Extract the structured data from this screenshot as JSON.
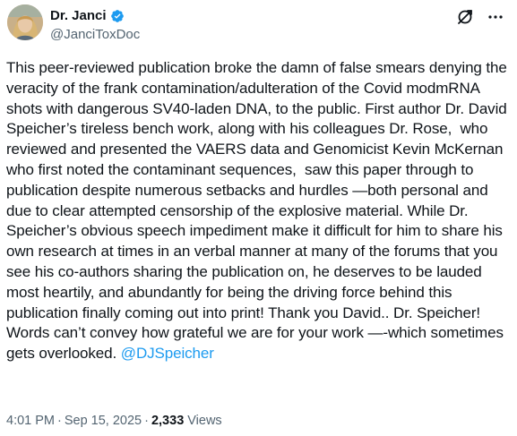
{
  "author": {
    "display_name": "Dr. Janci",
    "handle": "@JanciToxDoc",
    "verified_color": "#1d9bf0"
  },
  "icons": {
    "grok": "grok-icon",
    "more": "more-icon",
    "verified": "verified-badge-icon"
  },
  "post": {
    "text": "This peer-reviewed publication broke the damn of false smears denying the veracity of the frank contamination/adulteration of the Covid modmRNA shots with dangerous SV40-laden DNA, to the public. First author Dr. David Speicher’s tireless bench work, along with his colleagues Dr. Rose,  who reviewed and presented the VAERS data and Genomicist Kevin McKernan who first noted the contaminant sequences,  saw this paper through to publication despite numerous setbacks and hurdles —both personal and due to clear attempted censorship of the explosive material. While Dr. Speicher’s obvious speech impediment make it difficult for him to share his own research at times in an verbal manner at many of the forums that you see his co-authors sharing the publication on, he deserves to be lauded most heartily, and abundantly for being the driving force behind this publication finally coming out into print! Thank you David.. Dr. Speicher! Words can’t convey how grateful we are for your work —-which sometimes gets overlooked. ",
    "mention": "@DJSpeicher"
  },
  "meta": {
    "time": "4:01 PM",
    "separator": "·",
    "date": "Sep 15, 2025",
    "views_count": "2,333",
    "views_label": "Views"
  },
  "colors": {
    "text": "#0f1419",
    "secondary": "#536471",
    "link": "#1d9bf0"
  }
}
